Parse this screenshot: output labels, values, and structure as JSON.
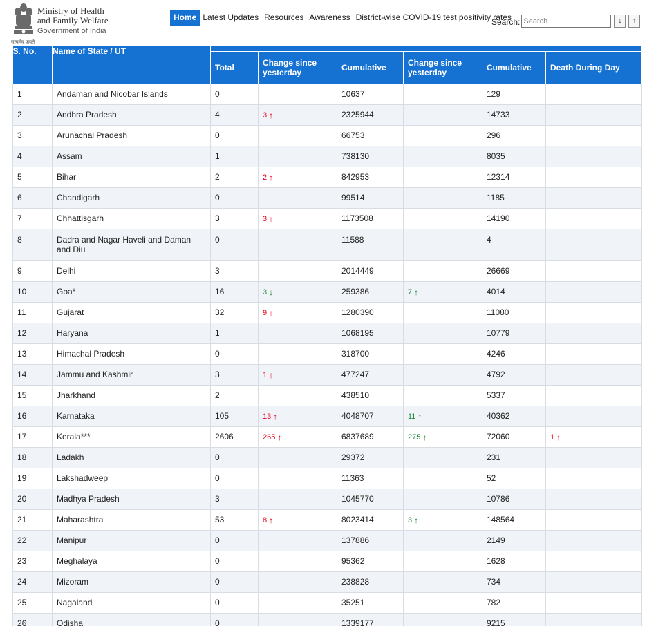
{
  "header": {
    "ministry_line1": "Ministry of Health",
    "ministry_line2": "and Family Welfare",
    "ministry_line3": "Government of India",
    "motto": "सत्यमेव जयते"
  },
  "nav": {
    "items": [
      {
        "label": "Home",
        "active": true
      },
      {
        "label": "Latest Updates"
      },
      {
        "label": "Resources"
      },
      {
        "label": "Awareness"
      },
      {
        "label": "District-wise COVID-19 test positivity rates"
      }
    ]
  },
  "search": {
    "label": "Search:",
    "placeholder": "Search",
    "down_label": "↓",
    "up_label": "↑"
  },
  "colors": {
    "header_blue": "#1572d3",
    "increase_red": "#e3001b",
    "green": "#1e8a3a"
  },
  "table": {
    "headers": {
      "sno": "S. No.",
      "name": "Name of State / UT",
      "total": "Total",
      "change1": "Change since yesterday",
      "cumulative1": "Cumulative",
      "change2": "Change since yesterday",
      "cumulative2": "Cumulative",
      "death_day": "Death During Day"
    },
    "rows": [
      {
        "sno": "1",
        "name": "Andaman and Nicobar Islands",
        "total": "0",
        "c1": "",
        "cum1": "10637",
        "c2": "",
        "cum2": "129",
        "d": ""
      },
      {
        "sno": "2",
        "name": "Andhra Pradesh",
        "total": "4",
        "c1": "3",
        "c1dir": "up-red",
        "cum1": "2325944",
        "c2": "",
        "cum2": "14733",
        "d": ""
      },
      {
        "sno": "3",
        "name": "Arunachal Pradesh",
        "total": "0",
        "c1": "",
        "cum1": "66753",
        "c2": "",
        "cum2": "296",
        "d": ""
      },
      {
        "sno": "4",
        "name": "Assam",
        "total": "1",
        "c1": "",
        "cum1": "738130",
        "c2": "",
        "cum2": "8035",
        "d": ""
      },
      {
        "sno": "5",
        "name": "Bihar",
        "total": "2",
        "c1": "2",
        "c1dir": "up-red",
        "cum1": "842953",
        "c2": "",
        "cum2": "12314",
        "d": ""
      },
      {
        "sno": "6",
        "name": "Chandigarh",
        "total": "0",
        "c1": "",
        "cum1": "99514",
        "c2": "",
        "cum2": "1185",
        "d": ""
      },
      {
        "sno": "7",
        "name": "Chhattisgarh",
        "total": "3",
        "c1": "3",
        "c1dir": "up-red",
        "cum1": "1173508",
        "c2": "",
        "cum2": "14190",
        "d": ""
      },
      {
        "sno": "8",
        "name": "Dadra and Nagar Haveli and Daman and Diu",
        "total": "0",
        "c1": "",
        "cum1": "11588",
        "c2": "",
        "cum2": "4",
        "d": "",
        "tall": true
      },
      {
        "sno": "9",
        "name": "Delhi",
        "total": "3",
        "c1": "",
        "cum1": "2014449",
        "c2": "",
        "cum2": "26669",
        "d": ""
      },
      {
        "sno": "10",
        "name": "Goa*",
        "total": "16",
        "c1": "3",
        "c1dir": "down-green",
        "cum1": "259386",
        "c2": "7",
        "c2dir": "up-green",
        "cum2": "4014",
        "d": ""
      },
      {
        "sno": "11",
        "name": "Gujarat",
        "total": "32",
        "c1": "9",
        "c1dir": "up-red",
        "cum1": "1280390",
        "c2": "",
        "cum2": "11080",
        "d": ""
      },
      {
        "sno": "12",
        "name": "Haryana",
        "total": "1",
        "c1": "",
        "cum1": "1068195",
        "c2": "",
        "cum2": "10779",
        "d": ""
      },
      {
        "sno": "13",
        "name": "Himachal Pradesh",
        "total": "0",
        "c1": "",
        "cum1": "318700",
        "c2": "",
        "cum2": "4246",
        "d": ""
      },
      {
        "sno": "14",
        "name": "Jammu and Kashmir",
        "total": "3",
        "c1": "1",
        "c1dir": "up-red",
        "cum1": "477247",
        "c2": "",
        "cum2": "4792",
        "d": ""
      },
      {
        "sno": "15",
        "name": "Jharkhand",
        "total": "2",
        "c1": "",
        "cum1": "438510",
        "c2": "",
        "cum2": "5337",
        "d": ""
      },
      {
        "sno": "16",
        "name": "Karnataka",
        "total": "105",
        "c1": "13",
        "c1dir": "up-red",
        "cum1": "4048707",
        "c2": "11",
        "c2dir": "up-green",
        "cum2": "40362",
        "d": ""
      },
      {
        "sno": "17",
        "name": "Kerala***",
        "total": "2606",
        "c1": "265",
        "c1dir": "up-red",
        "cum1": "6837689",
        "c2": "275",
        "c2dir": "up-green",
        "cum2": "72060",
        "d": "1",
        "ddir": "up-red"
      },
      {
        "sno": "18",
        "name": "Ladakh",
        "total": "0",
        "c1": "",
        "cum1": "29372",
        "c2": "",
        "cum2": "231",
        "d": ""
      },
      {
        "sno": "19",
        "name": "Lakshadweep",
        "total": "0",
        "c1": "",
        "cum1": "11363",
        "c2": "",
        "cum2": "52",
        "d": ""
      },
      {
        "sno": "20",
        "name": "Madhya Pradesh",
        "total": "3",
        "c1": "",
        "cum1": "1045770",
        "c2": "",
        "cum2": "10786",
        "d": ""
      },
      {
        "sno": "21",
        "name": "Maharashtra",
        "total": "53",
        "c1": "8",
        "c1dir": "up-red",
        "cum1": "8023414",
        "c2": "3",
        "c2dir": "up-green",
        "cum2": "148564",
        "d": ""
      },
      {
        "sno": "22",
        "name": "Manipur",
        "total": "0",
        "c1": "",
        "cum1": "137886",
        "c2": "",
        "cum2": "2149",
        "d": ""
      },
      {
        "sno": "23",
        "name": "Meghalaya",
        "total": "0",
        "c1": "",
        "cum1": "95362",
        "c2": "",
        "cum2": "1628",
        "d": ""
      },
      {
        "sno": "24",
        "name": "Mizoram",
        "total": "0",
        "c1": "",
        "cum1": "238828",
        "c2": "",
        "cum2": "734",
        "d": ""
      },
      {
        "sno": "25",
        "name": "Nagaland",
        "total": "0",
        "c1": "",
        "cum1": "35251",
        "c2": "",
        "cum2": "782",
        "d": ""
      },
      {
        "sno": "26",
        "name": "Odisha",
        "total": "0",
        "c1": "",
        "cum1": "1339177",
        "c2": "",
        "cum2": "9215",
        "d": ""
      }
    ]
  }
}
